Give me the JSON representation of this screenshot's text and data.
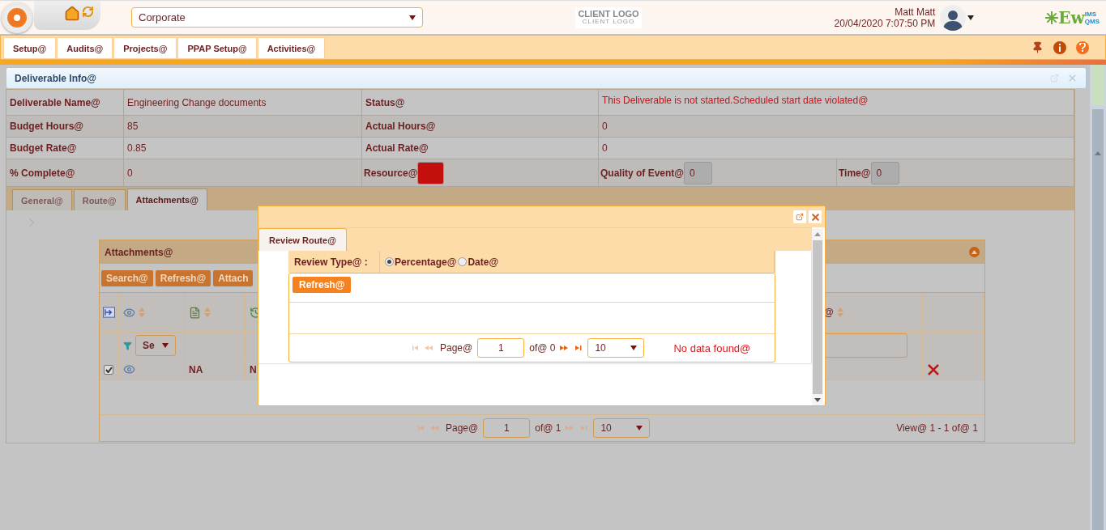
{
  "header": {
    "company_select": "Corporate",
    "client_logo": {
      "line_1": "CLIENT LOGO",
      "line_2": "CLIENT LOGO"
    },
    "user_name": "Matt Matt",
    "datetime": "20/04/2020 7:07:50 PM",
    "brand": {
      "name": "Ew",
      "sup": "IMS",
      "sub": "QMS"
    }
  },
  "menu": [
    {
      "label": "Setup@"
    },
    {
      "label": "Audits@"
    },
    {
      "label": "Projects@"
    },
    {
      "label": "PPAP Setup@"
    },
    {
      "label": "Activities@"
    }
  ],
  "panel": {
    "title": "Deliverable Info@",
    "info_rows": [
      {
        "cells": [
          {
            "kind": "label",
            "text": "Deliverable Name@"
          },
          {
            "kind": "text",
            "text": "Engineering Change documents"
          },
          {
            "kind": "label",
            "text": "Status@"
          },
          {
            "kind": "alert_wide",
            "text": "This Deliverable is not started.Scheduled start date violated@"
          }
        ]
      },
      {
        "cells": [
          {
            "kind": "label",
            "text": "Budget Hours@"
          },
          {
            "kind": "text",
            "text": "85"
          },
          {
            "kind": "label",
            "text": "Actual Hours@"
          },
          {
            "kind": "text_wide",
            "text": "0"
          }
        ]
      },
      {
        "cells": [
          {
            "kind": "label",
            "text": "Budget Rate@"
          },
          {
            "kind": "text",
            "text": "0.85"
          },
          {
            "kind": "label",
            "text": "Actual Rate@"
          },
          {
            "kind": "text_wide",
            "text": "0"
          }
        ]
      },
      {
        "cells": [
          {
            "kind": "label",
            "text": "% Complete@"
          },
          {
            "kind": "text",
            "text": "0"
          },
          {
            "kind": "swatch",
            "text": "Resource@",
            "color": "#c40f0f"
          },
          {
            "kind": "field",
            "text": "Quality of Event@",
            "value": "0"
          },
          {
            "kind": "field",
            "text": "Time@",
            "value": "0"
          }
        ]
      }
    ],
    "tabs": [
      {
        "label": "General@",
        "selected": false
      },
      {
        "label": "Route@",
        "selected": false
      },
      {
        "label": "Attachments@",
        "selected": true
      }
    ],
    "attachments": {
      "title": "Attachments@",
      "buttons": [
        "Search@",
        "Refresh@",
        "Attach"
      ],
      "columns": [
        {
          "kind": "select_all"
        },
        {
          "kind": "view"
        },
        {
          "kind": "document"
        },
        {
          "kind": "history"
        },
        {
          "kind": "text",
          "label": "@"
        },
        {
          "kind": "action"
        }
      ],
      "filter_select": "Se",
      "rows": [
        {
          "checked": true,
          "cells": [
            "NA",
            "N"
          ]
        }
      ],
      "pager": {
        "page_label": "Page@",
        "page": "1",
        "of": "of@ 1",
        "page_size": "10",
        "view": "View@ 1 - 1 of@ 1"
      }
    }
  },
  "modal": {
    "tabs": [
      {
        "label": "Review Route@",
        "selected": true
      }
    ],
    "review_type_label": "Review Type@ :",
    "review_options": [
      {
        "label": "Percentage@",
        "selected": true
      },
      {
        "label": "Date@",
        "selected": false
      }
    ],
    "refresh_button": "Refresh@",
    "pager": {
      "page_label": "Page@",
      "page": "1",
      "of": "of@ 0",
      "page_size": "10",
      "message": "No data found@"
    }
  }
}
